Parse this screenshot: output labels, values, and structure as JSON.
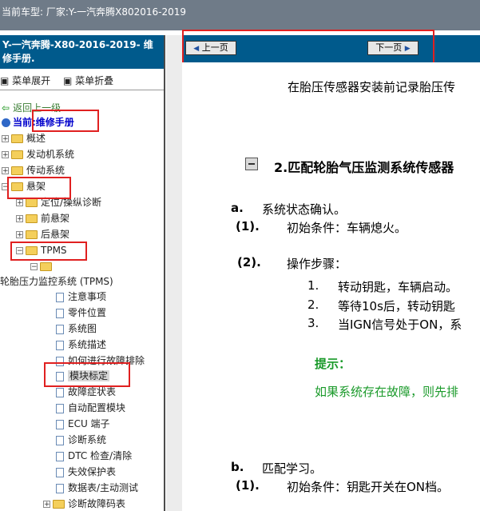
{
  "window": {
    "title": "当前车型:   厂家:Y-一汽奔腾X802016-2019"
  },
  "sidebar": {
    "title_line1": "Y-一汽奔腾-X80-2016-2019- 维",
    "title_line2": "修手册.",
    "expand_all": "菜单展开",
    "collapse_all": "菜单折叠",
    "back_label": "返回上一级",
    "current_label": "当前:维修手册",
    "items": {
      "overview": "概述",
      "engine": "发动机系统",
      "transmission": "传动系统",
      "suspension": "悬架",
      "alignment": "定位/操纵诊断",
      "front_susp": "前悬架",
      "rear_susp": "后悬架",
      "tpms": "TPMS",
      "tpms_full": "轮胎压力监控系统 (TPMS)",
      "notes": "注意事项",
      "parts_location": "零件位置",
      "system_diagram": "系统图",
      "system_desc": "系统描述",
      "how_to_troubleshoot": "如何进行故障排除",
      "module_calibration": "模块标定",
      "symptom_table": "故障症状表",
      "auto_config": "自动配置模块",
      "ecu_terminals": "ECU 端子",
      "diag_system": "诊断系统",
      "dtc_check": "DTC 检查/清除",
      "fail_safe": "失效保护表",
      "data_table": "数据表/主动测试",
      "dtc_table": "诊断故障码表"
    }
  },
  "nav": {
    "prev": "上一页",
    "next": "下一页"
  },
  "content": {
    "intro": "在胎压传感器安装前记录胎压传",
    "section_title": "2.匹配轮胎气压监测系统传感器",
    "a_label": "a.",
    "a_text": "系统状态确认。",
    "a1_num": "(1).",
    "a1_text": "初始条件：车辆熄火。",
    "a2_num": "(2).",
    "a2_text": "操作步骤：",
    "step1_num": "1.",
    "step1_text": "转动钥匙，车辆启动。",
    "step2_num": "2.",
    "step2_text": "等待10s后，转动钥匙",
    "step3_num": "3.",
    "step3_text": "当IGN信号处于ON，系",
    "hint_title": "提示：",
    "hint_text": "如果系统存在故障，则先排",
    "b_label": "b.",
    "b_text": "匹配学习。",
    "b1_num": "(1).",
    "b1_text": "初始条件：钥匙开关在ON档。"
  },
  "colors": {
    "accent": "#005a8c",
    "topbar": "#6f7b88",
    "highlight": "#e02020",
    "hint": "#1a9a2a"
  }
}
